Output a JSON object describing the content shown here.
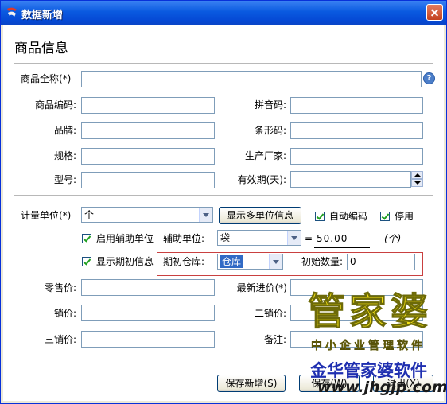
{
  "window": {
    "title": "数据新增",
    "heading": "商品信息"
  },
  "fields": {
    "fullname_label": "商品全称(*)",
    "code_label": "商品编码:",
    "pinyin_label": "拼音码:",
    "brand_label": "品牌:",
    "barcode_label": "条形码:",
    "spec_label": "规格:",
    "maker_label": "生产厂家:",
    "model_label": "型号:",
    "expiry_label": "有效期(天):"
  },
  "units": {
    "unit_label": "计量单位(*)",
    "unit_value": "个",
    "multi_unit_button": "显示多单位信息",
    "auto_code_label": "自动编码",
    "disabled_label": "停用",
    "enable_aux_label": "启用辅助单位",
    "aux_unit_label": "辅助单位:",
    "aux_unit_value": "袋",
    "equals": "=",
    "ratio_value": "50.00",
    "ratio_unit": "(个)"
  },
  "initial": {
    "show_initial_label": "显示期初信息",
    "warehouse_label": "期初仓库:",
    "warehouse_value": "仓库",
    "qty_label": "初始数量:",
    "qty_value": "0"
  },
  "prices": {
    "retail_label": "零售价:",
    "latest_label": "最新进价(*)",
    "price1_label": "一销价:",
    "price2_label": "二销价:",
    "price3_label": "三销价:",
    "note_label": "备注:"
  },
  "buttons": {
    "save_new": "保存新增(S)",
    "save_exit": "保存(W)",
    "exit": "退出(X)"
  },
  "watermark": {
    "brand": "管家婆",
    "slogan": "中小企业管理软件",
    "company": "金华管家婆软件",
    "url": "www.jhgjp.com"
  },
  "icons": {
    "help": "?"
  }
}
